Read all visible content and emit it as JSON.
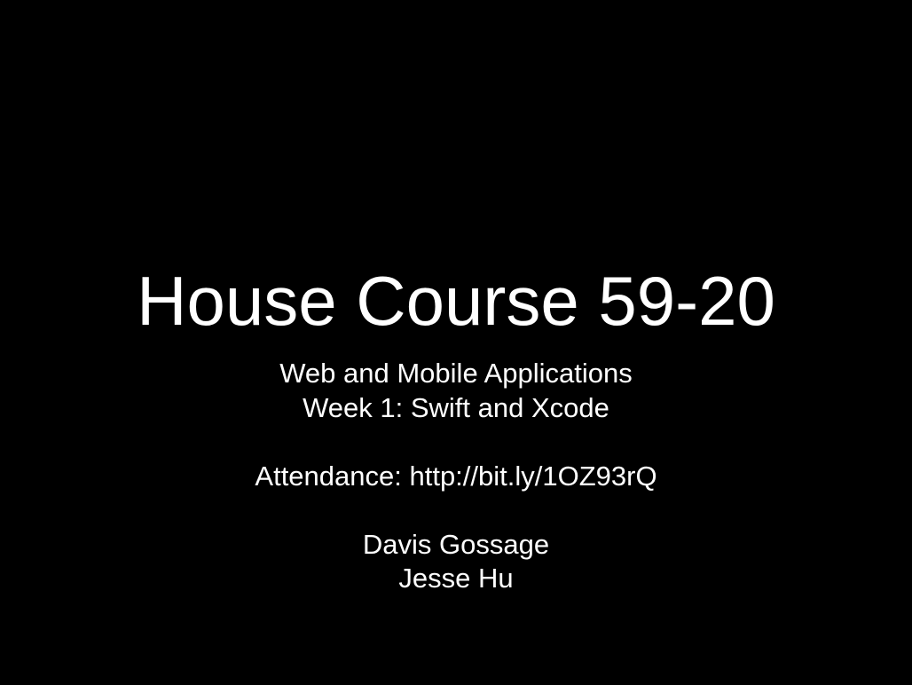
{
  "slide": {
    "title": "House Course 59-20",
    "subtitle_line_1": "Web and Mobile Applications",
    "subtitle_line_2": "Week 1: Swift and Xcode",
    "attendance": "Attendance: http://bit.ly/1OZ93rQ",
    "presenter_1": "Davis Gossage",
    "presenter_2": "Jesse Hu"
  }
}
